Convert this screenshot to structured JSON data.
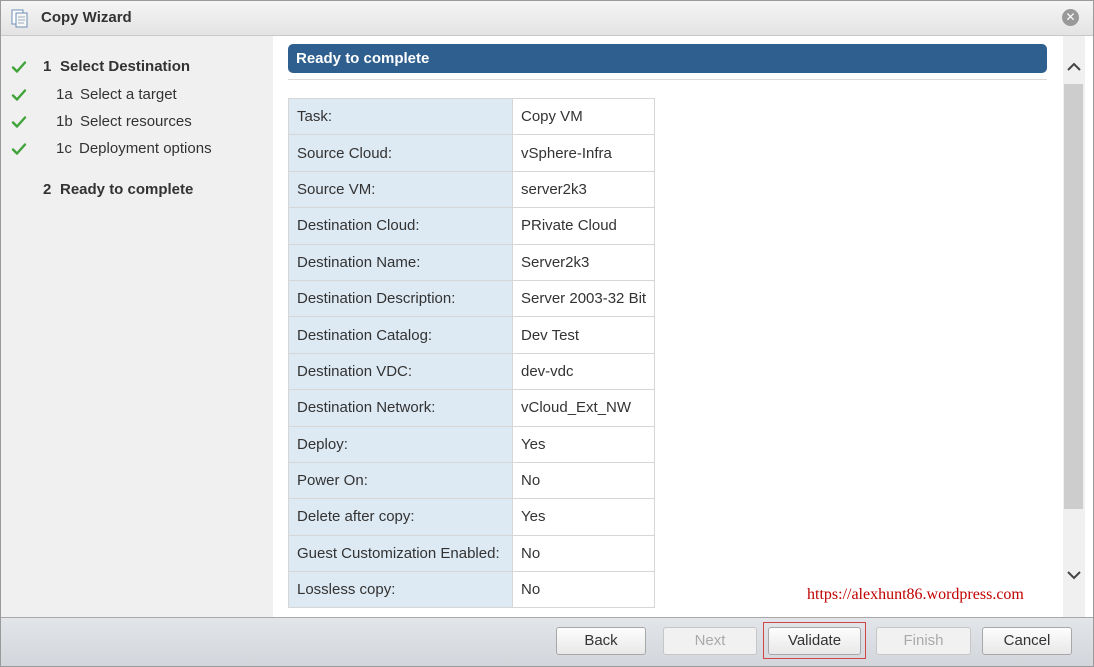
{
  "window": {
    "title": "Copy Wizard",
    "close_glyph": "✕",
    "icon": "copy-document-icon"
  },
  "nav": {
    "steps": [
      {
        "number": "1",
        "label": "Select Destination",
        "completed": true
      },
      {
        "number": "1a",
        "label": "Select a target",
        "completed": true
      },
      {
        "number": "1b",
        "label": "Select resources",
        "completed": true
      },
      {
        "number": "1c",
        "label": "Deployment options",
        "completed": true
      },
      {
        "number": "2",
        "label": "Ready to complete",
        "completed": false
      }
    ]
  },
  "content": {
    "header": "Ready to complete",
    "rows": [
      {
        "key": "Task:",
        "value": "Copy VM"
      },
      {
        "key": "Source Cloud:",
        "value": "vSphere-Infra"
      },
      {
        "key": "Source VM:",
        "value": "server2k3"
      },
      {
        "key": "Destination Cloud:",
        "value": "PRivate Cloud"
      },
      {
        "key": "Destination Name:",
        "value": "Server2k3"
      },
      {
        "key": "Destination Description:",
        "value": "Server 2003-32 Bit"
      },
      {
        "key": "Destination Catalog:",
        "value": "Dev Test"
      },
      {
        "key": "Destination VDC:",
        "value": "dev-vdc"
      },
      {
        "key": "Destination Network:",
        "value": "vCloud_Ext_NW"
      },
      {
        "key": "Deploy:",
        "value": "Yes"
      },
      {
        "key": "Power On:",
        "value": "No"
      },
      {
        "key": "Delete after copy:",
        "value": "Yes"
      },
      {
        "key": "Guest Customization Enabled:",
        "value": "No"
      },
      {
        "key": "Lossless copy:",
        "value": "No"
      }
    ],
    "watermark": "https://alexhunt86.wordpress.com"
  },
  "footer": {
    "back": "Back",
    "next": "Next",
    "validate": "Validate",
    "finish": "Finish",
    "cancel": "Cancel"
  },
  "colors": {
    "header_bg": "#2e5f8e",
    "check_green": "#3fa33a",
    "key_cell_bg": "#dde9f3",
    "watermark": "#c00000",
    "highlight": "#d24545"
  }
}
